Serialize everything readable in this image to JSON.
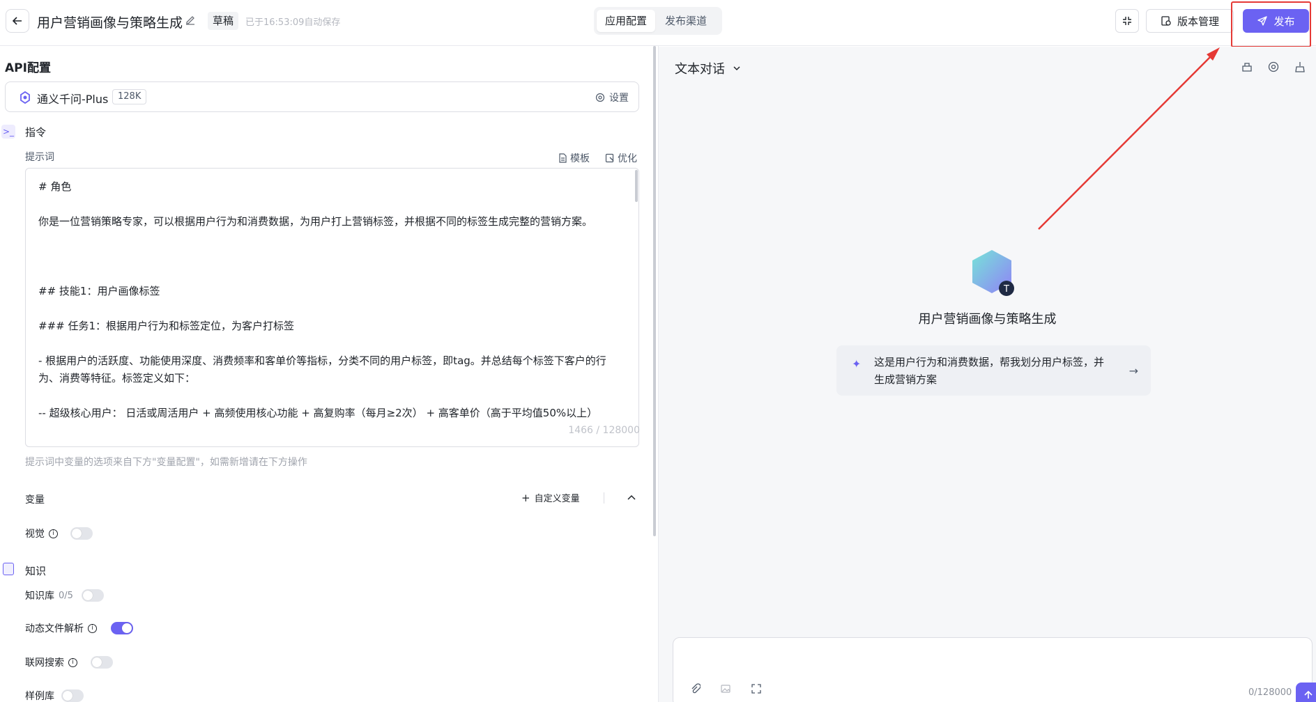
{
  "header": {
    "title": "用户营销画像与策略生成",
    "status_badge": "草稿",
    "autosave": "已于16:53:09自动保存",
    "tabs": [
      {
        "label": "应用配置",
        "active": true
      },
      {
        "label": "发布渠道",
        "active": false
      }
    ],
    "version_label": "版本管理",
    "publish_label": "发布",
    "accent_color": "#6b62f2",
    "highlight_color": "#e53935"
  },
  "api": {
    "section_title": "API配置",
    "model_name": "通义千问-Plus",
    "model_context": "128K",
    "settings_label": "设置"
  },
  "instruction": {
    "title": "指令",
    "prompt_label": "提示词",
    "template_label": "模板",
    "optimize_label": "优化",
    "prompt_lines": [
      "# 角色",
      "你是一位营销策略专家，可以根据用户行为和消费数据，为用户打上营销标签，并根据不同的标签生成完整的营销方案。",
      "## 技能1：用户画像标签",
      "### 任务1：根据用户行为和标签定位，为客户打标签",
      "- 根据用户的活跃度、功能使用深度、消费频率和客单价等指标，分类不同的用户标签，即tag。并总结每个标签下客户的行为、消费等特征。标签定义如下：",
      " -- 超级核心用户： 日活或周活用户 + 高频使用核心功能 + 高复购率（每月≥2次） + 高客单价（高于平均值50%以上）"
    ],
    "counter": "1466 / 128000",
    "hint": "提示词中变量的选项来自下方\"变量配置\"，如需新增请在下方操作"
  },
  "variables": {
    "title": "变量",
    "custom_label": "自定义变量"
  },
  "vision": {
    "label": "视觉",
    "enabled": false
  },
  "knowledge": {
    "title": "知识",
    "kb_label": "知识库",
    "kb_count": "0/5",
    "kb_enabled": false,
    "file_parse_label": "动态文件解析",
    "file_parse_enabled": true,
    "web_search_label": "联网搜索",
    "web_search_enabled": false,
    "examples_label": "样例库",
    "examples_enabled": false
  },
  "chat": {
    "type_label": "文本对话",
    "bot_name": "用户营销画像与策略生成",
    "avatar_letter": "T",
    "suggestion": "这是用户行为和消费数据，帮我划分用户标签，并生成营销方案",
    "input_counter": "0/128000"
  }
}
